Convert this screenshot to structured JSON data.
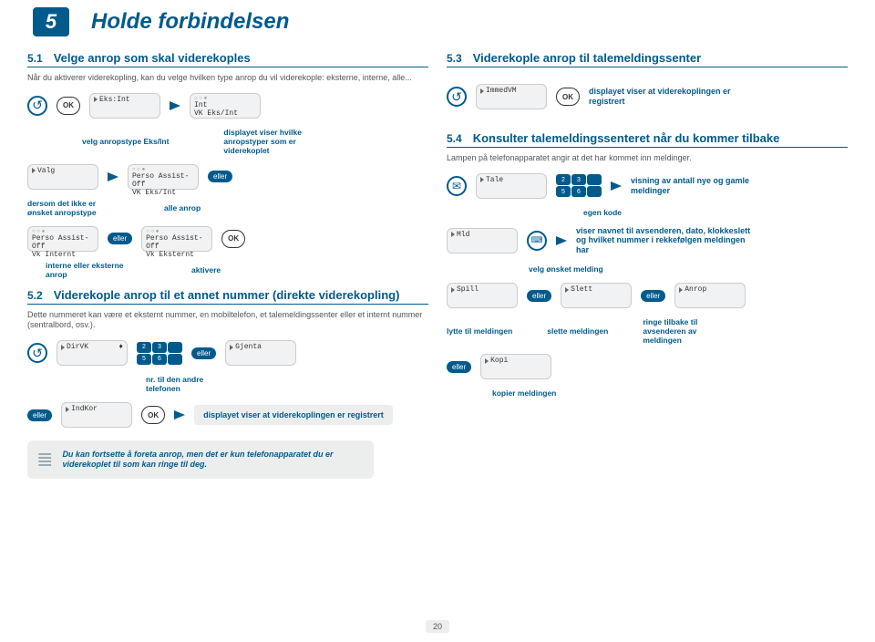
{
  "chapter_num": "5",
  "chapter_title": "Holde forbindelsen",
  "eller": "eller",
  "ok": "OK",
  "s51": {
    "num": "5.1",
    "title": "Velge anrop som skal viderekoples",
    "intro": "Når du aktiverer viderekopling, kan du velge hvilken type anrop du vil viderekople: eksterne, interne, alle...",
    "d1": "Eks:Int",
    "d2_top": "Int",
    "d2_bot": "VK Eks/Int",
    "col1": "velg anropstype Eks/Int",
    "col2": "displayet viser hvilke anropstyper som er viderekoplet",
    "d3": "Valg",
    "d4_top": "Perso Assist-Off",
    "d4_bot": "VK Eks/Int",
    "left_label": "dersom det ikke er ønsket anropstype",
    "right_label": "alle anrop",
    "d5_top": "Perso Assist-Off",
    "d5_bot": "Vk Internt",
    "d6_top": "Perso Assist-Off",
    "d6_bot": "Vk Eksternt",
    "bottom_label": "interne eller eksterne anrop",
    "activate": "aktivere"
  },
  "s52": {
    "num": "5.2",
    "title": "Viderekople anrop til et annet nummer (direkte viderekopling)",
    "intro": "Dette nummeret kan være et eksternt nummer, en mobiltelefon, et talemeldingssenter eller et internt nummer (sentralbord, osv.).",
    "d1": "DirVK",
    "d2": "Gjenta",
    "note_label": "nr. til den andre telefonen",
    "d3": "IndKor",
    "result": "displayet viser at viderekoplingen er registrert",
    "footer": "Du kan fortsette å foreta anrop, men det er kun telefonapparatet du er viderekoplet til som kan ringe til deg."
  },
  "s53": {
    "num": "5.3",
    "title": "Viderekople anrop til talemeldingssenter",
    "d1": "ImmedVM",
    "result": "displayet viser at viderekoplingen er registrert"
  },
  "s54": {
    "num": "5.4",
    "title": "Konsulter talemeldingssenteret når du kommer tilbake",
    "intro": "Lampen på telefonapparatet angir at det har kommet inn meldinger.",
    "d1": "Tale",
    "label1": "egen kode",
    "right1": "visning av antall nye og gamle meldinger",
    "d2": "Mld",
    "label2": "velg ønsket melding",
    "right2": "viser navnet til avsenderen, dato, klokkeslett og hvilket nummer i rekkefølgen meldingen har",
    "d3": "Spill",
    "d4": "Slett",
    "d5": "Anrop",
    "c1": "lytte til meldingen",
    "c2": "slette meldingen",
    "c3": "ringe tilbake til avsenderen av meldingen",
    "d6": "Kopi",
    "c4": "kopier meldingen"
  },
  "page": "20"
}
